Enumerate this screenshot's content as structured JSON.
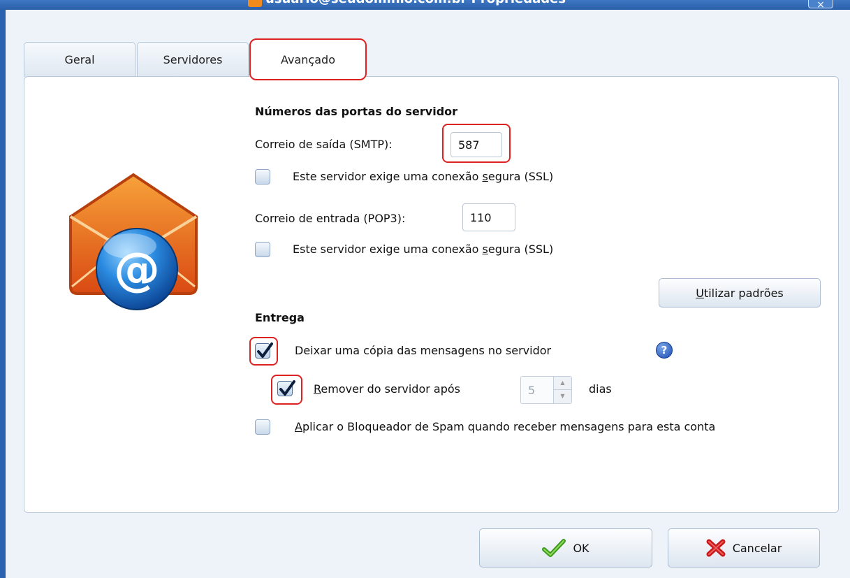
{
  "window": {
    "title": "usuario@seudominio.com.br Propriedades",
    "close_label": "×"
  },
  "tabs": [
    {
      "label": "Geral"
    },
    {
      "label": "Servidores"
    },
    {
      "label": "Avançado",
      "active": true
    }
  ],
  "server_ports": {
    "heading": "Números das portas do servidor",
    "smtp_label": "Correio de saída (SMTP):",
    "smtp_value": "587",
    "smtp_ssl_label_pre": "Este servidor exige uma conexão ",
    "smtp_ssl_label_ul": "s",
    "smtp_ssl_label_post": "egura (SSL)",
    "smtp_ssl_checked": false,
    "pop3_label": "Correio de entrada (POP3):",
    "pop3_value": "110",
    "pop3_ssl_label_pre": "Este servidor exige uma conexão ",
    "pop3_ssl_label_ul": "s",
    "pop3_ssl_label_post": "egura (SSL)",
    "pop3_ssl_checked": false,
    "defaults_button_ul": "U",
    "defaults_button_rest": "tilizar padrões"
  },
  "delivery": {
    "heading": "Entrega",
    "leave_copy_label": "Deixar uma cópia das mensagens no servidor",
    "leave_copy_checked": true,
    "help_icon": "question-help-icon",
    "remove_label_ul": "R",
    "remove_label_rest": "emover do servidor após",
    "remove_checked": true,
    "remove_days_value": "5",
    "days_label": "dias",
    "spam_label_ul": "A",
    "spam_label_rest": "plicar o Bloqueador de Spam quando receber mensagens para esta conta",
    "spam_checked": false
  },
  "footer": {
    "ok_label": "OK",
    "cancel_label": "Cancelar"
  },
  "colors": {
    "highlight": "#dd2222",
    "frame": "#2a62b0",
    "dialog_bg": "#eef3f9"
  }
}
